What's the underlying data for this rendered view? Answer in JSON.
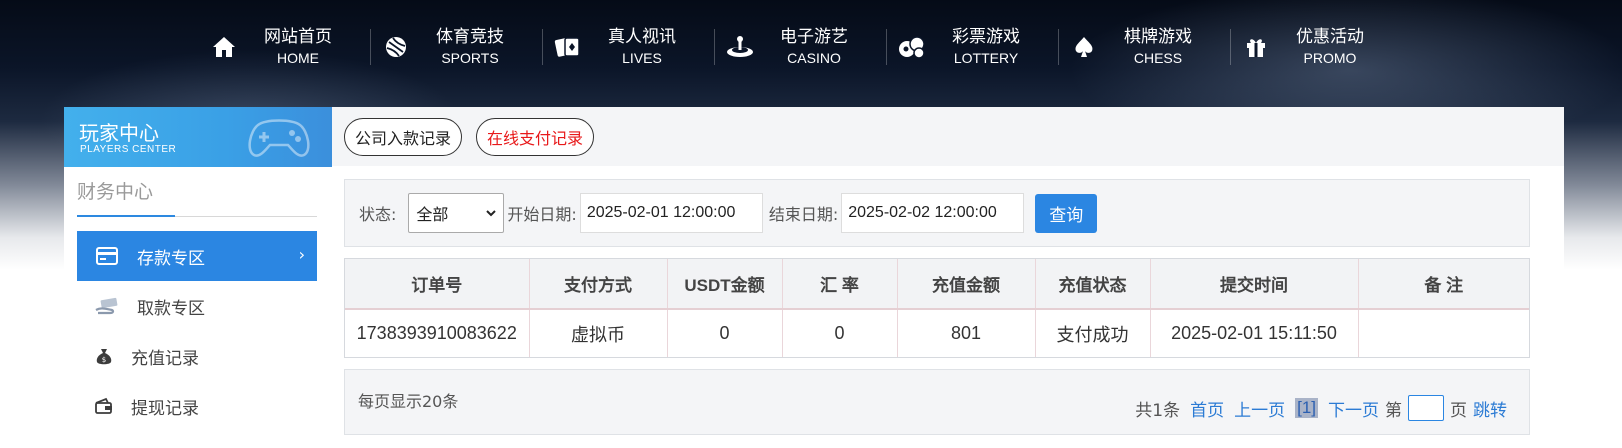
{
  "nav": [
    {
      "cn": "网站首页",
      "en": "HOME",
      "icon": "home-icon"
    },
    {
      "cn": "体育竞技",
      "en": "SPORTS",
      "icon": "ball-icon"
    },
    {
      "cn": "真人视讯",
      "en": "LIVES",
      "icon": "cards-icon"
    },
    {
      "cn": "电子游艺",
      "en": "CASINO",
      "icon": "roulette-icon"
    },
    {
      "cn": "彩票游戏",
      "en": "LOTTERY",
      "icon": "lottery-balls-icon"
    },
    {
      "cn": "棋牌游戏",
      "en": "CHESS",
      "icon": "spade-icon"
    },
    {
      "cn": "优惠活动",
      "en": "PROMO",
      "icon": "gift-icon"
    }
  ],
  "sidebar": {
    "header_cn": "玩家中心",
    "header_en": "PLAYERS CENTER",
    "section_title": "财务中心",
    "items": [
      {
        "label": "存款专区",
        "icon": "card-icon",
        "active": true
      },
      {
        "label": "取款专区",
        "icon": "cash-icon",
        "active": false
      },
      {
        "label": "充值记录",
        "icon": "money-bag-icon",
        "active": false
      },
      {
        "label": "提现记录",
        "icon": "wallet-icon",
        "active": false
      }
    ]
  },
  "tabs": [
    {
      "label": "公司入款记录",
      "active": false
    },
    {
      "label": "在线支付记录",
      "active": true
    }
  ],
  "filter": {
    "status_label": "状态:",
    "status_value": "全部",
    "start_label": "开始日期:",
    "start_value": "2025-02-01 12:00:00",
    "end_label": "结束日期:",
    "end_value": "2025-02-02 12:00:00",
    "query_label": "查询"
  },
  "table": {
    "headers": [
      "订单号",
      "支付方式",
      "USDT金额",
      "汇 率",
      "充值金额",
      "充值状态",
      "提交时间",
      "备 注"
    ],
    "rows": [
      [
        "1738393910083622",
        "虚拟币",
        "0",
        "0",
        "801",
        "支付成功",
        "2025-02-01 15:11:50",
        ""
      ]
    ]
  },
  "pagination": {
    "per_page_text": "每页显示20条",
    "total_text": "共1条",
    "first": "首页",
    "prev": "上一页",
    "current": "[1]",
    "next": "下一页",
    "page_prefix": "第",
    "page_suffix": "页",
    "jump": "跳转"
  },
  "colors": {
    "accent": "#2b86e2",
    "active_tab_text": "#e8191a"
  }
}
